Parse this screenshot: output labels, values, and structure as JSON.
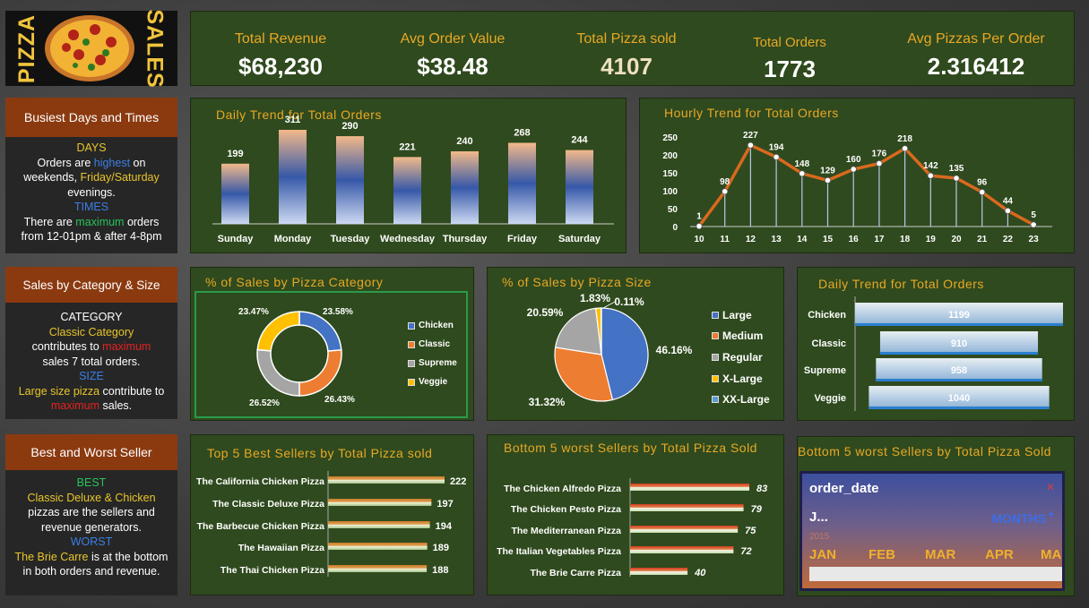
{
  "logo": {
    "left_text": "PIZZA",
    "right_text": "SALES"
  },
  "kpis": [
    {
      "label": "Total  Revenue",
      "value": "$68,230"
    },
    {
      "label": "Avg Order Value",
      "value": "$38.48"
    },
    {
      "label": "Total Pizza sold",
      "value": "4107"
    },
    {
      "label": "Total  Orders",
      "value": "1773"
    },
    {
      "label": "Avg Pizzas Per Order",
      "value": "2.316412"
    }
  ],
  "busiest": {
    "header": "Busiest Days and Times",
    "days_h": "DAYS",
    "l1a": "Orders are ",
    "l1b": "highest",
    "l1c": " on",
    "l2a": "weekends, ",
    "l2b": "Friday/Saturday",
    "l3": "evenings.",
    "times_h": "TIMES",
    "l4a": "There are ",
    "l4b": "maximum",
    "l4c": " orders",
    "l5": "from 12-01pm & after 4-8pm"
  },
  "category_card": {
    "header": "Sales by Category & Size",
    "cat_h": "CATEGORY",
    "l1": "Classic Category",
    "l2a": "contributes to ",
    "l2b": "maximum",
    "l3": "sales 7 total orders.",
    "size_h": "SIZE",
    "l4a": "Large size pizza",
    "l4b": " contribute to",
    "l5a": "maximum",
    "l5b": " sales."
  },
  "best_worst": {
    "header": "Best and Worst Seller",
    "best_h": "BEST",
    "l1": "Classic Deluxe & Chicken",
    "l2": "pizzas are the sellers and",
    "l3": "revenue generators.",
    "worst_h": "WORST",
    "l4a": "The Brie Carre",
    "l4b": " is at the bottom",
    "l5": "in both orders and revenue."
  },
  "titles": {
    "daily": "Daily Trend for Total Orders",
    "hourly": "Hourly Trend for Total Orders",
    "category": "%  of Sales by  Pizza Category",
    "size": "%  of  Sales by  Pizza Size",
    "daily2": "Daily Trend for Total Orders",
    "top5": "Top 5  Best Sellers by Total  Pizza sold",
    "bottom5": "Bottom 5 worst Sellers by Total Pizza Sold",
    "slicer_panel": "Bottom 5 worst Sellers by Total Pizza Sold"
  },
  "slicer": {
    "field": "order_date",
    "selected": "J...",
    "level": "MONTHS",
    "year": "2015",
    "months": [
      "JAN",
      "FEB",
      "MAR",
      "APR",
      "MA"
    ]
  },
  "colors": {
    "accent": "#e8a825",
    "panel": "#2f4a1e",
    "line": "#d9691e",
    "pie_blue": "#4472c4",
    "pie_orange": "#ed7d31",
    "pie_gray": "#a5a5a5",
    "pie_yellow": "#ffc000",
    "pie_lightblue": "#5b9bd5"
  },
  "chart_data": [
    {
      "id": "daily",
      "type": "bar",
      "categories": [
        "Sunday",
        "Monday",
        "Tuesday",
        "Wednesday",
        "Thursday",
        "Friday",
        "Saturday"
      ],
      "values": [
        199,
        311,
        290,
        221,
        240,
        268,
        244
      ]
    },
    {
      "id": "hourly",
      "type": "line",
      "x": [
        "10",
        "11",
        "12",
        "13",
        "14",
        "15",
        "16",
        "17",
        "18",
        "19",
        "20",
        "21",
        "22",
        "23"
      ],
      "values": [
        1,
        98,
        227,
        194,
        148,
        129,
        160,
        176,
        218,
        142,
        135,
        96,
        44,
        5
      ],
      "ylim": [
        0,
        250
      ],
      "yticks": [
        0,
        50,
        100,
        150,
        200,
        250
      ]
    },
    {
      "id": "category",
      "type": "pie",
      "categories": [
        "Chicken",
        "Classic",
        "Supreme",
        "Veggie"
      ],
      "values": [
        23.58,
        26.43,
        26.52,
        23.47
      ],
      "labels": [
        "23.58%",
        "26.43%",
        "26.52%",
        "23.47%"
      ]
    },
    {
      "id": "size",
      "type": "pie",
      "categories": [
        "Large",
        "Medium",
        "Regular",
        "X-Large",
        "XX-Large"
      ],
      "values": [
        46.16,
        31.32,
        20.59,
        1.83,
        0.11
      ],
      "labels": [
        "46.16%",
        "31.32%",
        "20.59%",
        "1.83%",
        "0.11%"
      ]
    },
    {
      "id": "daily2",
      "type": "bar",
      "categories": [
        "Chicken",
        "Classic",
        "Supreme",
        "Veggie"
      ],
      "values": [
        1199,
        910,
        958,
        1040
      ]
    },
    {
      "id": "top5",
      "type": "bar",
      "categories": [
        "The California Chicken Pizza",
        "The Classic Deluxe Pizza",
        "The Barbecue Chicken Pizza",
        "The Hawaiian Pizza",
        "The Thai Chicken Pizza"
      ],
      "values": [
        222,
        197,
        194,
        189,
        188
      ]
    },
    {
      "id": "bottom5",
      "type": "bar",
      "categories": [
        "The Chicken Alfredo Pizza",
        "The Chicken Pesto Pizza",
        "The Mediterranean Pizza",
        "The Italian Vegetables Pizza",
        "The Brie Carre Pizza"
      ],
      "values": [
        83,
        79,
        75,
        72,
        40
      ]
    }
  ]
}
